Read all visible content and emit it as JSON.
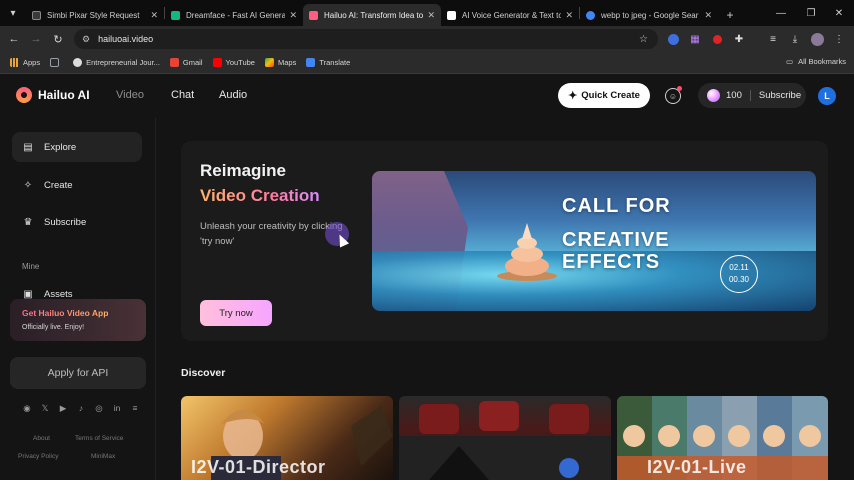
{
  "browser": {
    "tabs": [
      {
        "title": "Simbi Pixar Style Request",
        "favicon_color": "#3a3a3a",
        "active": false
      },
      {
        "title": "Dreamface - Fast AI Generati",
        "favicon_color": "#10b981",
        "active": false
      },
      {
        "title": "Hailuo AI: Transform Idea to",
        "favicon_color": "#ff5e7e",
        "active": true
      },
      {
        "title": "AI Voice Generator & Text to",
        "favicon_color": "#ffffff",
        "active": false
      },
      {
        "title": "webp to jpeg - Google Sear",
        "favicon_color": "#4285f4",
        "active": false
      }
    ],
    "url": "hailuoai.video",
    "bookmarks": [
      {
        "label": "Apps",
        "color": "#e8a33d"
      },
      {
        "label": "",
        "color": "#9aa0a6"
      },
      {
        "label": "Entrepreneurial Jour...",
        "color": "#dcdcdc"
      },
      {
        "label": "Gmail",
        "color": "#ea4335"
      },
      {
        "label": "YouTube",
        "color": "#ff0000"
      },
      {
        "label": "Maps",
        "color": "#34a853"
      },
      {
        "label": "Translate",
        "color": "#4285f4"
      }
    ],
    "all_bookmarks": "All Bookmarks"
  },
  "header": {
    "brand": "Hailuo AI",
    "nav": [
      "Video",
      "Chat",
      "Audio"
    ],
    "quick_create": "Quick Create",
    "credits": "100",
    "subscribe": "Subscribe",
    "avatar_letter": "L"
  },
  "sidebar": {
    "items": [
      {
        "label": "Explore",
        "icon": "explore-icon",
        "active": true
      },
      {
        "label": "Create",
        "icon": "create-icon",
        "active": false
      },
      {
        "label": "Subscribe",
        "icon": "subscribe-icon",
        "active": false
      }
    ],
    "section_mine": "Mine",
    "assets": "Assets",
    "promo_title": "Get Hailuo Video App",
    "promo_sub": "Officially live. Enjoy!",
    "api_button": "Apply for API",
    "socials": [
      "discord-icon",
      "x-icon",
      "youtube-icon",
      "tiktok-icon",
      "instagram-icon",
      "linkedin-icon",
      "more-icon"
    ],
    "footer_links": [
      "About",
      "Terms of Service",
      "Privacy Policy",
      "MiniMax"
    ]
  },
  "hero": {
    "title_line1": "Reimagine",
    "title_line2": "Video Creation",
    "description": "Unleash your creativity by clicking 'try now'",
    "try_button": "Try now",
    "banner_line1": "CALL FOR",
    "banner_line2": "CREATIVE",
    "banner_line3": "EFFECTS",
    "banner_date_start": "02.11",
    "banner_date_end": "00.30"
  },
  "discover": {
    "title": "Discover",
    "cards": [
      {
        "label": "I2V-01-Director"
      },
      {
        "label": ""
      },
      {
        "label": "I2V-01-Live"
      }
    ]
  }
}
